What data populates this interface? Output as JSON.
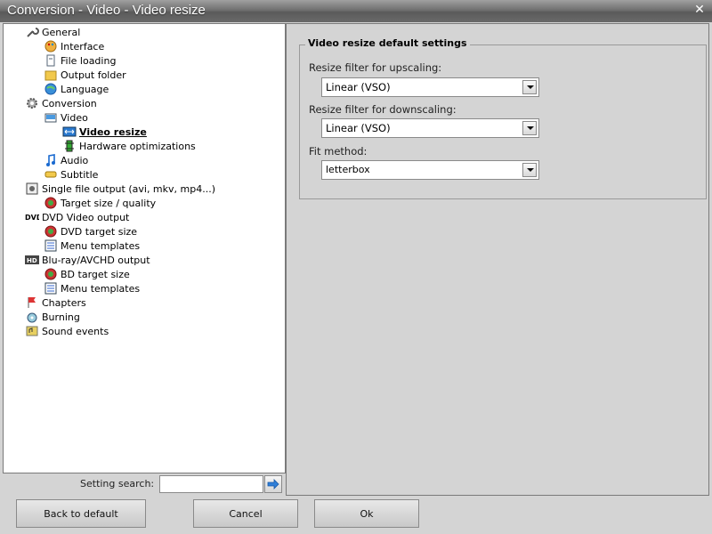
{
  "window": {
    "title": "Conversion - Video - Video resize"
  },
  "tree": [
    {
      "label": "General",
      "indent": 0,
      "icon": "wrench-icon"
    },
    {
      "label": "Interface",
      "indent": 1,
      "icon": "palette-icon"
    },
    {
      "label": "File loading",
      "indent": 1,
      "icon": "file-icon"
    },
    {
      "label": "Output folder",
      "indent": 1,
      "icon": "folder-icon"
    },
    {
      "label": "Language",
      "indent": 1,
      "icon": "globe-icon"
    },
    {
      "label": "Conversion",
      "indent": 0,
      "icon": "gear-icon"
    },
    {
      "label": "Video",
      "indent": 1,
      "icon": "video-icon"
    },
    {
      "label": "Video resize",
      "indent": 2,
      "icon": "resize-icon",
      "selected": true
    },
    {
      "label": "Hardware optimizations",
      "indent": 2,
      "icon": "chip-icon"
    },
    {
      "label": "Audio",
      "indent": 1,
      "icon": "music-note-icon"
    },
    {
      "label": "Subtitle",
      "indent": 1,
      "icon": "subtitle-icon"
    },
    {
      "label": "Single file output (avi, mkv, mp4...)",
      "indent": 0,
      "icon": "film-icon"
    },
    {
      "label": "Target size / quality",
      "indent": 1,
      "icon": "target-icon"
    },
    {
      "label": "DVD Video output",
      "indent": 0,
      "icon": "dvd-icon"
    },
    {
      "label": "DVD target size",
      "indent": 1,
      "icon": "target-icon"
    },
    {
      "label": "Menu templates",
      "indent": 1,
      "icon": "menu-icon"
    },
    {
      "label": "Blu-ray/AVCHD output",
      "indent": 0,
      "icon": "hd-icon"
    },
    {
      "label": "BD target size",
      "indent": 1,
      "icon": "target-icon"
    },
    {
      "label": "Menu templates",
      "indent": 1,
      "icon": "menu-icon"
    },
    {
      "label": "Chapters",
      "indent": 0,
      "icon": "flag-icon"
    },
    {
      "label": "Burning",
      "indent": 0,
      "icon": "disc-burn-icon"
    },
    {
      "label": "Sound events",
      "indent": 0,
      "icon": "sound-icon"
    }
  ],
  "settings": {
    "group_title": "Video resize default settings",
    "upscale_label": "Resize filter for upscaling:",
    "upscale_value": "Linear (VSO)",
    "downscale_label": "Resize filter for downscaling:",
    "downscale_value": "Linear (VSO)",
    "fit_label": "Fit method:",
    "fit_value": "letterbox"
  },
  "search": {
    "label": "Setting search:",
    "value": ""
  },
  "buttons": {
    "back": "Back to default",
    "cancel": "Cancel",
    "ok": "Ok"
  },
  "colors": {
    "titlebar": "#6a6a6a",
    "panel_bg": "#d4d4d4",
    "tree_bg": "#ffffff"
  }
}
